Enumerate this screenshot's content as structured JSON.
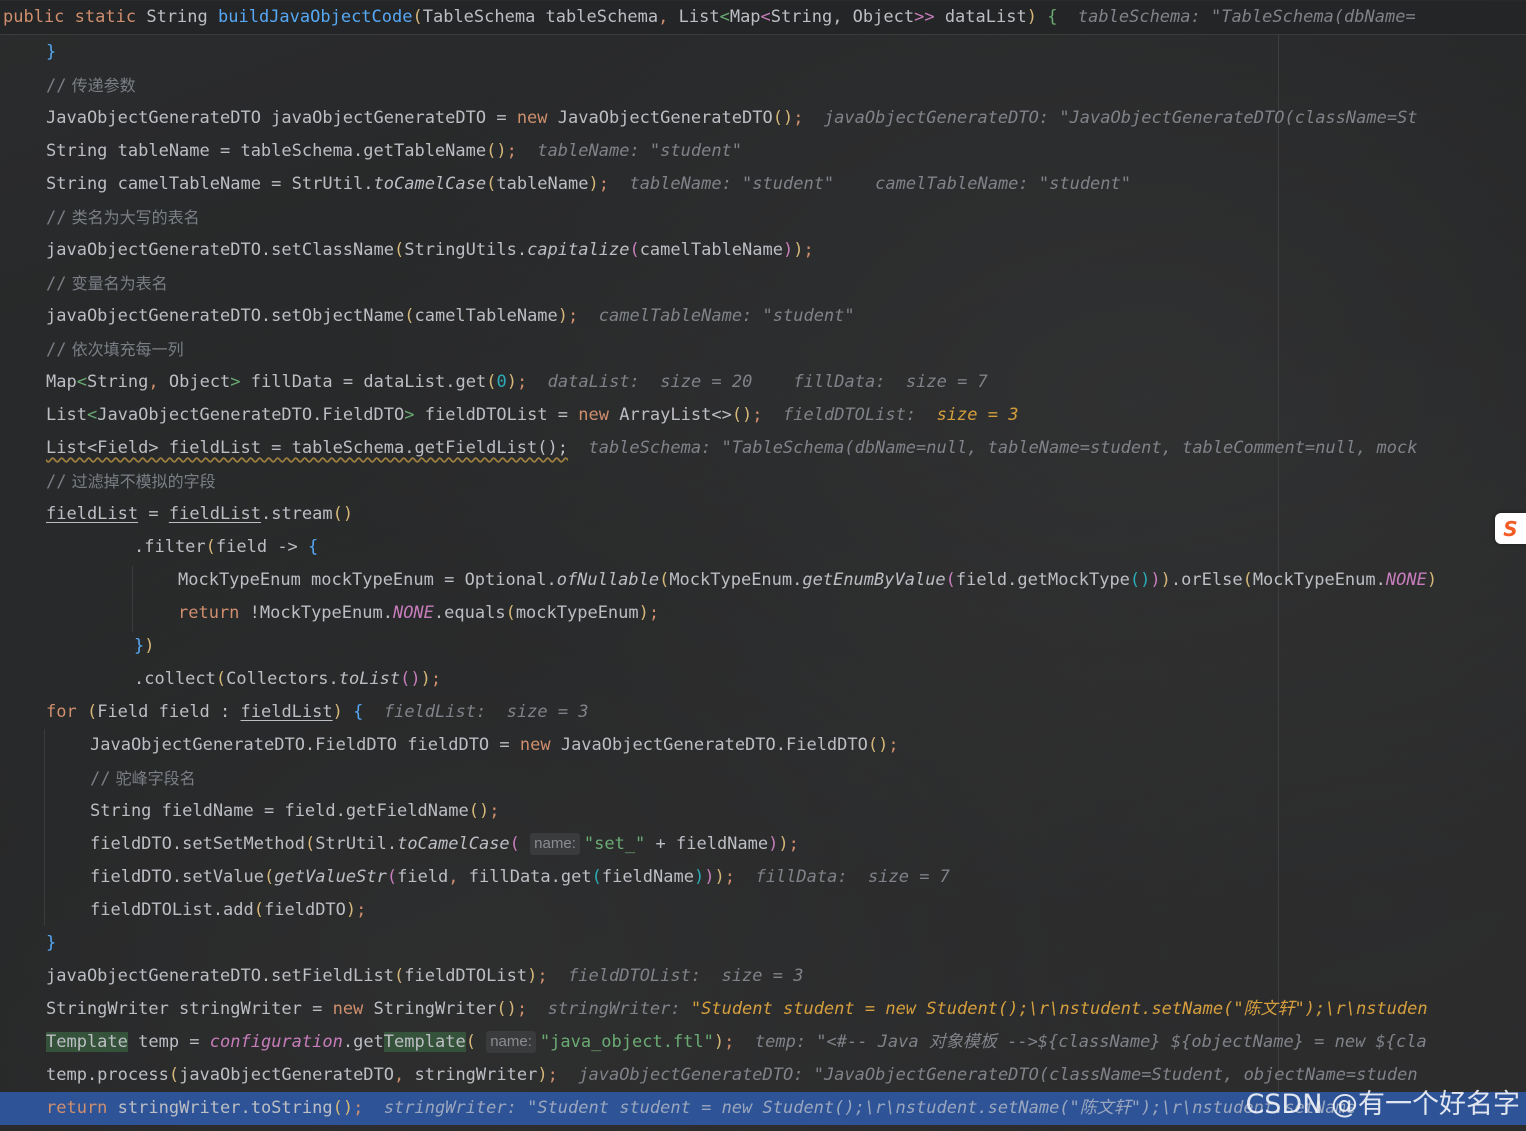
{
  "editor": {
    "signature": {
      "public": "public",
      "static": "static",
      "ret_type": "String",
      "method_name": "buildJavaObjectCode",
      "paren_open": "(",
      "param1": "TableSchema tableSchema",
      "comma1": ", ",
      "list_type": "List",
      "generic_open": "<",
      "map_type": "Map",
      "generic_inner_open": "<",
      "map_args": "String, Object",
      "generic_close": ">>",
      "param2": " dataList",
      "paren_close": ")",
      "brace": " {",
      "hint": "tableSchema: \"TableSchema(dbName="
    },
    "line_01": {
      "text": "}"
    },
    "line_02": {
      "slashes": "//",
      "comment": " 传递参数"
    },
    "line_03": {
      "decl": "JavaObjectGenerateDTO javaObjectGenerateDTO = ",
      "kw_new": "new",
      "ctor": " JavaObjectGenerateDTO",
      "parens": "()",
      "semi": ";",
      "hint": "javaObjectGenerateDTO: \"JavaObjectGenerateDTO(className=St"
    },
    "line_04": {
      "decl": "String tableName = tableSchema.getTableName",
      "parens": "()",
      "semi": ";",
      "hint": "tableName: \"student\""
    },
    "line_05": {
      "decl": "String camelTableName = StrUtil.",
      "method": "toCamelCase",
      "open": "(",
      "arg": "tableName",
      "close": ")",
      "semi": ";",
      "hint1": "tableName: \"student\"",
      "hint2": "camelTableName: \"student\""
    },
    "line_06": {
      "slashes": "//",
      "comment": " 类名为大写的表名"
    },
    "line_07": {
      "call": "javaObjectGenerateDTO.setClassName",
      "open1": "(",
      "obj": "StringUtils.",
      "method": "capitalize",
      "open2": "(",
      "arg": "camelTableName",
      "close2": ")",
      "close1": ")",
      "semi": ";"
    },
    "line_08": {
      "slashes": "//",
      "comment": " 变量名为表名"
    },
    "line_09": {
      "call": "javaObjectGenerateDTO.setObjectName",
      "open": "(",
      "arg": "camelTableName",
      "close": ")",
      "semi": ";",
      "hint": "camelTableName: \"student\""
    },
    "line_10": {
      "slashes": "//",
      "comment": " 依次填充每一列"
    },
    "line_11": {
      "type": "Map",
      "gopen": "<",
      "gargs1": "String",
      "gcomma": ", ",
      "gargs2": "Object",
      "gclose": ">",
      "rest": " fillData = dataList.get",
      "open": "(",
      "num": "0",
      "close": ")",
      "semi": ";",
      "hint1": "dataList:  size = 20",
      "hint2": "fillData:  size = 7"
    },
    "line_12": {
      "type": "List",
      "gopen": "<",
      "garg": "JavaObjectGenerateDTO.FieldDTO",
      "gclose": ">",
      "rest": " fieldDTOList = ",
      "kw_new": "new",
      "ctor": " ArrayList<>",
      "parens": "()",
      "semi": ";",
      "hint_name": "fieldDTOList:  ",
      "hint_val": "size = 3"
    },
    "line_13": {
      "code": "List<Field> fieldList = tableSchema.getFieldList();",
      "hint": "tableSchema: \"TableSchema(dbName=null, tableName=student, tableComment=null, mock"
    },
    "line_14": {
      "slashes": "//",
      "comment": " 过滤掉不模拟的字段"
    },
    "line_15": {
      "var1": "fieldList",
      "eq": " = ",
      "var2": "fieldList",
      "rest": ".stream",
      "parens": "()"
    },
    "line_16": {
      "call": ".filter",
      "open": "(",
      "arrow": "field -> ",
      "brace": "{"
    },
    "line_17": {
      "decl": "MockTypeEnum mockTypeEnum = Optional.",
      "m1": "ofNullable",
      "o1": "(",
      "obj": "MockTypeEnum.",
      "m2": "getEnumByValue",
      "o2": "(",
      "inner": "field.getMockType",
      "p3": "()",
      "c2": ")",
      "c1": ")",
      "tail": ".orElse",
      "o3": "(",
      "obj2": "MockTypeEnum.",
      "cst": "NONE",
      "c3": ")"
    },
    "line_18": {
      "kw_return": "return",
      "pre": " !MockTypeEnum.",
      "cst": "NONE",
      "call": ".equals",
      "open": "(",
      "arg": "mockTypeEnum",
      "close": ")",
      "semi": ";"
    },
    "line_19": {
      "brace": "}",
      "paren": ")"
    },
    "line_20": {
      "call": ".collect",
      "open1": "(",
      "obj": "Collectors.",
      "method": "toList",
      "parens": "()",
      "close1": ")",
      "semi": ";"
    },
    "line_21": {
      "kw_for": "for",
      "open": " (",
      "decl": "Field field : ",
      "var": "fieldList",
      "close": ") ",
      "brace": "{",
      "hint": "fieldList:  size = 3"
    },
    "line_22": {
      "decl": "JavaObjectGenerateDTO.FieldDTO fieldDTO = ",
      "kw_new": "new",
      "ctor": " JavaObjectGenerateDTO.FieldDTO",
      "parens": "()",
      "semi": ";"
    },
    "line_23": {
      "slashes": "//",
      "comment": " 驼峰字段名"
    },
    "line_24": {
      "decl": "String fieldName = field.getFieldName",
      "parens": "()",
      "semi": ";"
    },
    "line_25": {
      "call": "fieldDTO.setSetMethod",
      "open1": "(",
      "obj": "StrUtil.",
      "method": "toCamelCase",
      "open2": "(",
      "param_hint": "name:",
      "str": "\"set_\"",
      "rest": " + fieldName",
      "close2": ")",
      "close1": ")",
      "semi": ";"
    },
    "line_26": {
      "call": "fieldDTO.setValue",
      "open1": "(",
      "method": "getValueStr",
      "open2": "(",
      "arg1": "field",
      "comma": ", ",
      "arg2": "fillData.get",
      "open3": "(",
      "arg3": "fieldName",
      "close3": ")",
      "close2": ")",
      "close1": ")",
      "semi": ";",
      "hint": "fillData:  size = 7"
    },
    "line_27": {
      "call": "fieldDTOList.add",
      "open": "(",
      "arg": "fieldDTO",
      "close": ")",
      "semi": ";"
    },
    "line_28": {
      "text": "}"
    },
    "line_29": {
      "call": "javaObjectGenerateDTO.setFieldList",
      "open": "(",
      "arg": "fieldDTOList",
      "close": ")",
      "semi": ";",
      "hint": "fieldDTOList:  size = 3"
    },
    "line_30": {
      "decl": "StringWriter stringWriter = ",
      "kw_new": "new",
      "ctor": " StringWriter",
      "parens": "()",
      "semi": ";",
      "hint_name": "stringWriter: ",
      "hint_val": "\"Student student = new Student();\\r\\nstudent.setName(\"陈文轩\");\\r\\nstuden"
    },
    "line_31": {
      "tpl1": "Template",
      "mid": " temp = ",
      "field": "configuration",
      "get": ".get",
      "tpl2": "Template",
      "open": "(",
      "param_hint": "name:",
      "str": "\"java_object.ftl\"",
      "close": ")",
      "semi": ";",
      "hint": "temp: \"<#-- Java 对象模板 -->${className} ${objectName} = new ${cla"
    },
    "line_32": {
      "call": "temp.process",
      "open": "(",
      "arg1": "javaObjectGenerateDTO",
      "comma": ", ",
      "arg2": "stringWriter",
      "close": ")",
      "semi": ";",
      "hint": "javaObjectGenerateDTO: \"JavaObjectGenerateDTO(className=Student, objectName=studen"
    },
    "line_33": {
      "kw_return": "return",
      "rest": " stringWriter.toString",
      "parens": "()",
      "semi": ";",
      "hint": "stringWriter: \"Student student = new Student();\\r\\nstudent.setName(\"陈文轩\");\\r\\nstudent.setName"
    }
  },
  "watermark": "CSDN @有一个好名字",
  "badge": "S"
}
